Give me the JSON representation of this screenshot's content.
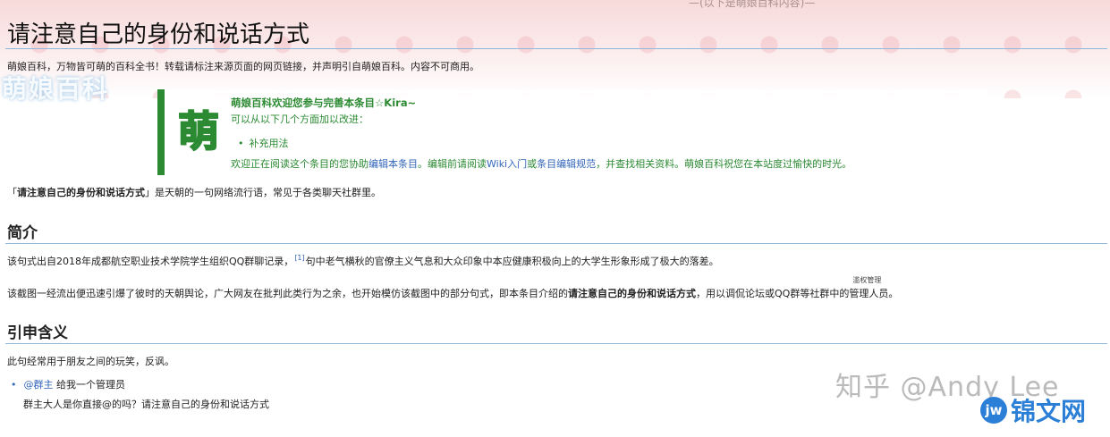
{
  "header": {
    "title": "请注意自己的身份和说话方式",
    "top_cut_text": "—(以下是萌娘百科内容)—",
    "logo_word": "萌娘百科",
    "site_note": "萌娘百科，万物皆可萌的百科全书！转载请标注来源页面的网页链接，并声明引自萌娘百科。内容不可商用。"
  },
  "notice": {
    "glyph": "萌",
    "heading": "萌娘百科欢迎您参与完善本条目☆Kira~",
    "line1": "可以从以下几个方面加以改进：",
    "bullet": "补充用法",
    "foot_a": "欢迎正在阅读这个条目的您协助",
    "foot_link1": "编辑本条目",
    "foot_b": "。编辑前请阅读",
    "foot_link2": "Wiki入门",
    "foot_c": "或",
    "foot_link3": "条目编辑规范",
    "foot_d": "，并查找相关资料。萌娘百科祝您在本站度过愉快的时光。",
    "accent": "#2b8a32"
  },
  "intro": {
    "prefix": "「",
    "bold": "请注意自己的身份和说话方式",
    "suffix": "」是天朝的一句网络流行语，常见于各类聊天社群里。"
  },
  "section1": {
    "heading": "简介",
    "p1_a": "该句式出自2018年成都航空职业技术学院学生组织QQ群聊记录，",
    "p1_ref": "[1]",
    "p1_b": "句中老气横秋的官僚主义气息和大众印象中本应健康积极向上的大学生形象形成了极大的落差。",
    "p2_a": "该截图一经流出便迅速引爆了彼时的天朝舆论，广大网友在批判此类行为之余，也开始模仿该截图中的部分句式，即本条目介绍的",
    "p2_bold": "请注意自己的身份和说话方式",
    "p2_b": "，用以调侃论坛或QQ群等社群中的",
    "p2_ruby_top": "滥权管理",
    "p2_ruby_base": "管理人员",
    "p2_end": "。"
  },
  "section2": {
    "heading": "引申含义",
    "p1": "此句经常用于朋友之间的玩笑，反讽。",
    "item_link": "@群主",
    "item_text": " 给我一个管理员",
    "item_sub": "群主大人是你直接@的吗？请注意自己的身份和说话方式"
  },
  "watermarks": {
    "zhihu": "知乎 @Andy Lee",
    "brand_circle": "jw",
    "brand_text": "锦文网"
  },
  "colors": {
    "link": "#3366bb",
    "heading_rule": "#8fb7d9",
    "banner_pink": "#f7dada",
    "brand_blue": "#2c7fd6"
  }
}
